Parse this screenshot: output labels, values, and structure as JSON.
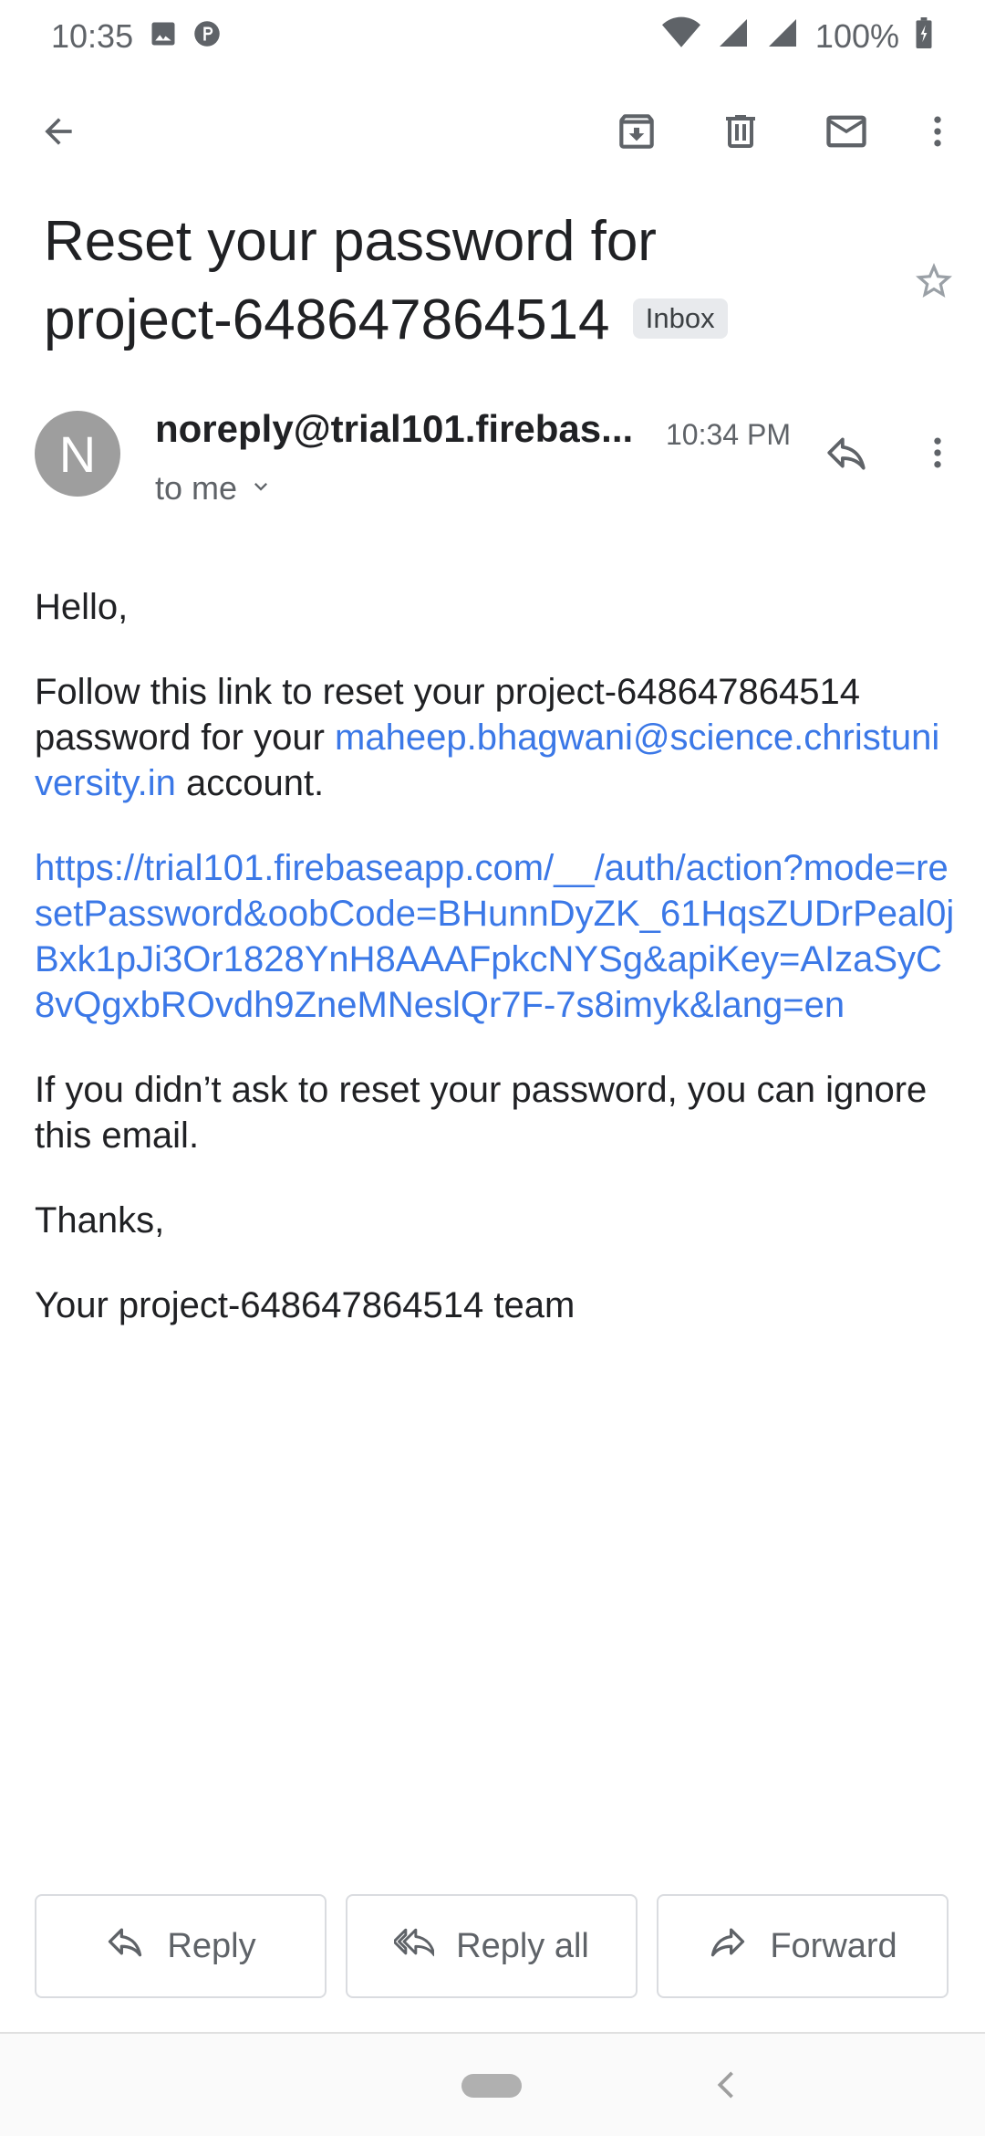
{
  "status_bar": {
    "time": "10:35",
    "battery": "100%",
    "icons": [
      "image-icon",
      "p-icon",
      "wifi-icon",
      "signal-icon",
      "signal-icon",
      "battery-icon"
    ]
  },
  "toolbar": {
    "icons": [
      "back-arrow-icon",
      "archive-icon",
      "delete-icon",
      "mark-unread-icon",
      "more-vert-icon"
    ]
  },
  "email": {
    "subject_line1": "Reset your password for",
    "subject_line2": "project-648647864514",
    "label": "Inbox",
    "avatar_letter": "N",
    "sender": "noreply@trial101.firebas...",
    "time": "10:34 PM",
    "recipient": "to me",
    "body": {
      "greeting": "Hello,",
      "p1_before": "Follow this link to reset your project-648647864514 password for your ",
      "p1_email": "maheep.bhagwani@science.christuniversity.in",
      "p1_after": " account.",
      "url": "https://trial101.firebaseapp.com/__/auth/action?mode=resetPassword&oobCode=BHunnDyZK_61HqsZUDrPeal0jBxk1pJi3Or1828YnH8AAAFpkcNYSg&apiKey=AIzaSyC8vQgxbROvdh9ZneMNeslQr7F-7s8imyk&lang=en",
      "p3": "If you didn’t ask to reset your password, you can ignore this email.",
      "thanks": "Thanks,",
      "signature": "Your project-648647864514 team"
    }
  },
  "actions": {
    "reply": "Reply",
    "reply_all": "Reply all",
    "forward": "Forward"
  },
  "colors": {
    "link": "#3b78e7",
    "avatar": "#9e9e9e",
    "icon": "#5f6368"
  }
}
